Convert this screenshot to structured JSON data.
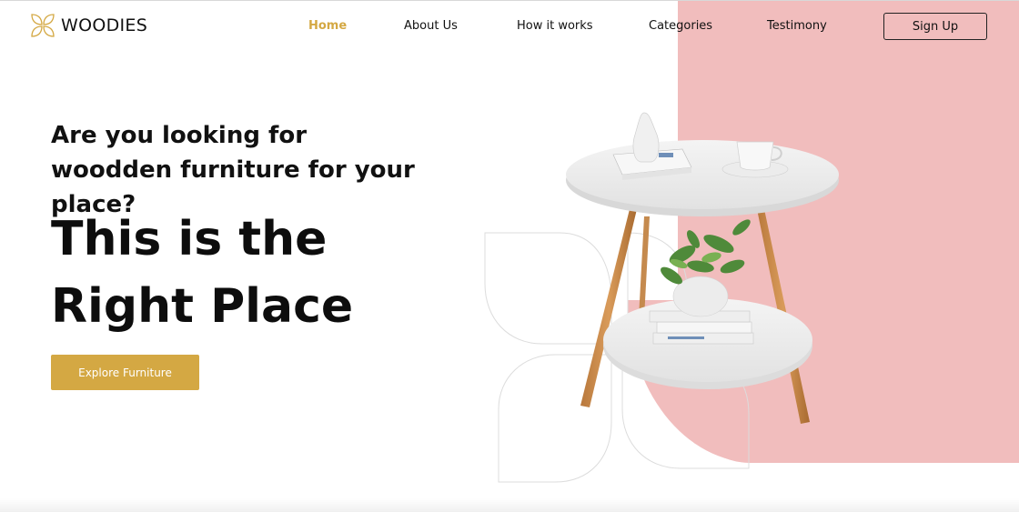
{
  "brand": {
    "name": "WOODIES",
    "accent_color": "#d4a843",
    "pink_color": "#f1bdbd",
    "logo_icon": "four-leaf-icon"
  },
  "nav": {
    "items": [
      {
        "label": "Home",
        "active": true
      },
      {
        "label": "About Us",
        "active": false
      },
      {
        "label": "How it works",
        "active": false
      },
      {
        "label": "Categories",
        "active": false
      },
      {
        "label": "Testimony",
        "active": false
      }
    ],
    "signup_label": "Sign Up"
  },
  "hero": {
    "subtitle_part1": "Are you looking for ",
    "subtitle_bold1": "woodden furniture",
    "subtitle_part2": " for your place?",
    "title_line1": "This is the",
    "title_line2": "Right Place",
    "cta_label": "Explore Furniture"
  },
  "illustration": {
    "subject": "side-table-icon"
  }
}
